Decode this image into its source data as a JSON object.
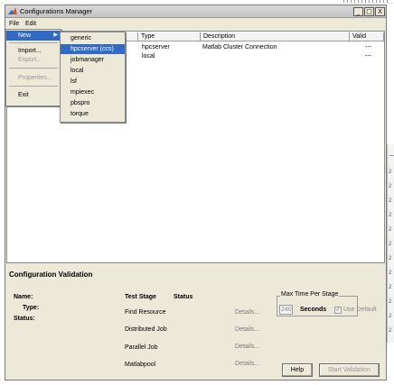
{
  "window": {
    "title": "Configurations Manager",
    "controls": {
      "minimize": "_",
      "maximize": "□",
      "close": "X"
    }
  },
  "menubar": {
    "file": "File",
    "edit": "Edit"
  },
  "file_menu": {
    "new": "New",
    "import": "Import...",
    "export": "Export...",
    "properties": "Properties...",
    "exit": "Exit"
  },
  "new_submenu": {
    "items": [
      "generic",
      "hpcserver (ccs)",
      "jobmanager",
      "local",
      "lsf",
      "mpiexec",
      "pbspro",
      "torque"
    ],
    "highlighted": "hpcserver (ccs)"
  },
  "table": {
    "columns": [
      "",
      "Type",
      "Description",
      "Valid"
    ],
    "rows": [
      {
        "type": "hpcserver",
        "description": "Matlab Cluster Connection",
        "valid": "---"
      },
      {
        "type": "local",
        "description": "",
        "valid": "---"
      }
    ]
  },
  "validation": {
    "title": "Configuration Validation",
    "labels": {
      "name": "Name:",
      "type": "Type:",
      "status": "Status:"
    },
    "columns": {
      "test_stage": "Test Stage",
      "status": "Status"
    },
    "stages": [
      {
        "name": "Find Resource",
        "details": "Details..."
      },
      {
        "name": "Distributed Job",
        "details": "Details..."
      },
      {
        "name": "Parallel Job",
        "details": "Details..."
      },
      {
        "name": "Matlabpool",
        "details": "Details..."
      }
    ],
    "max_time": {
      "legend": "Max Time Per Stage",
      "value": "240",
      "unit": "Seconds",
      "use_default_label": "Use Default",
      "use_default_checked": true
    },
    "help_button": "Help",
    "start_button": "Start Validation"
  },
  "background_window": {
    "fragments": [
      "2",
      "2",
      "2",
      "2",
      "2",
      "2",
      "2",
      "2",
      "2",
      "2",
      "2",
      "2"
    ]
  },
  "colors": {
    "highlight": "#316ac5",
    "window_bg": "#ece9d8",
    "disabled": "#9a9a9a"
  }
}
